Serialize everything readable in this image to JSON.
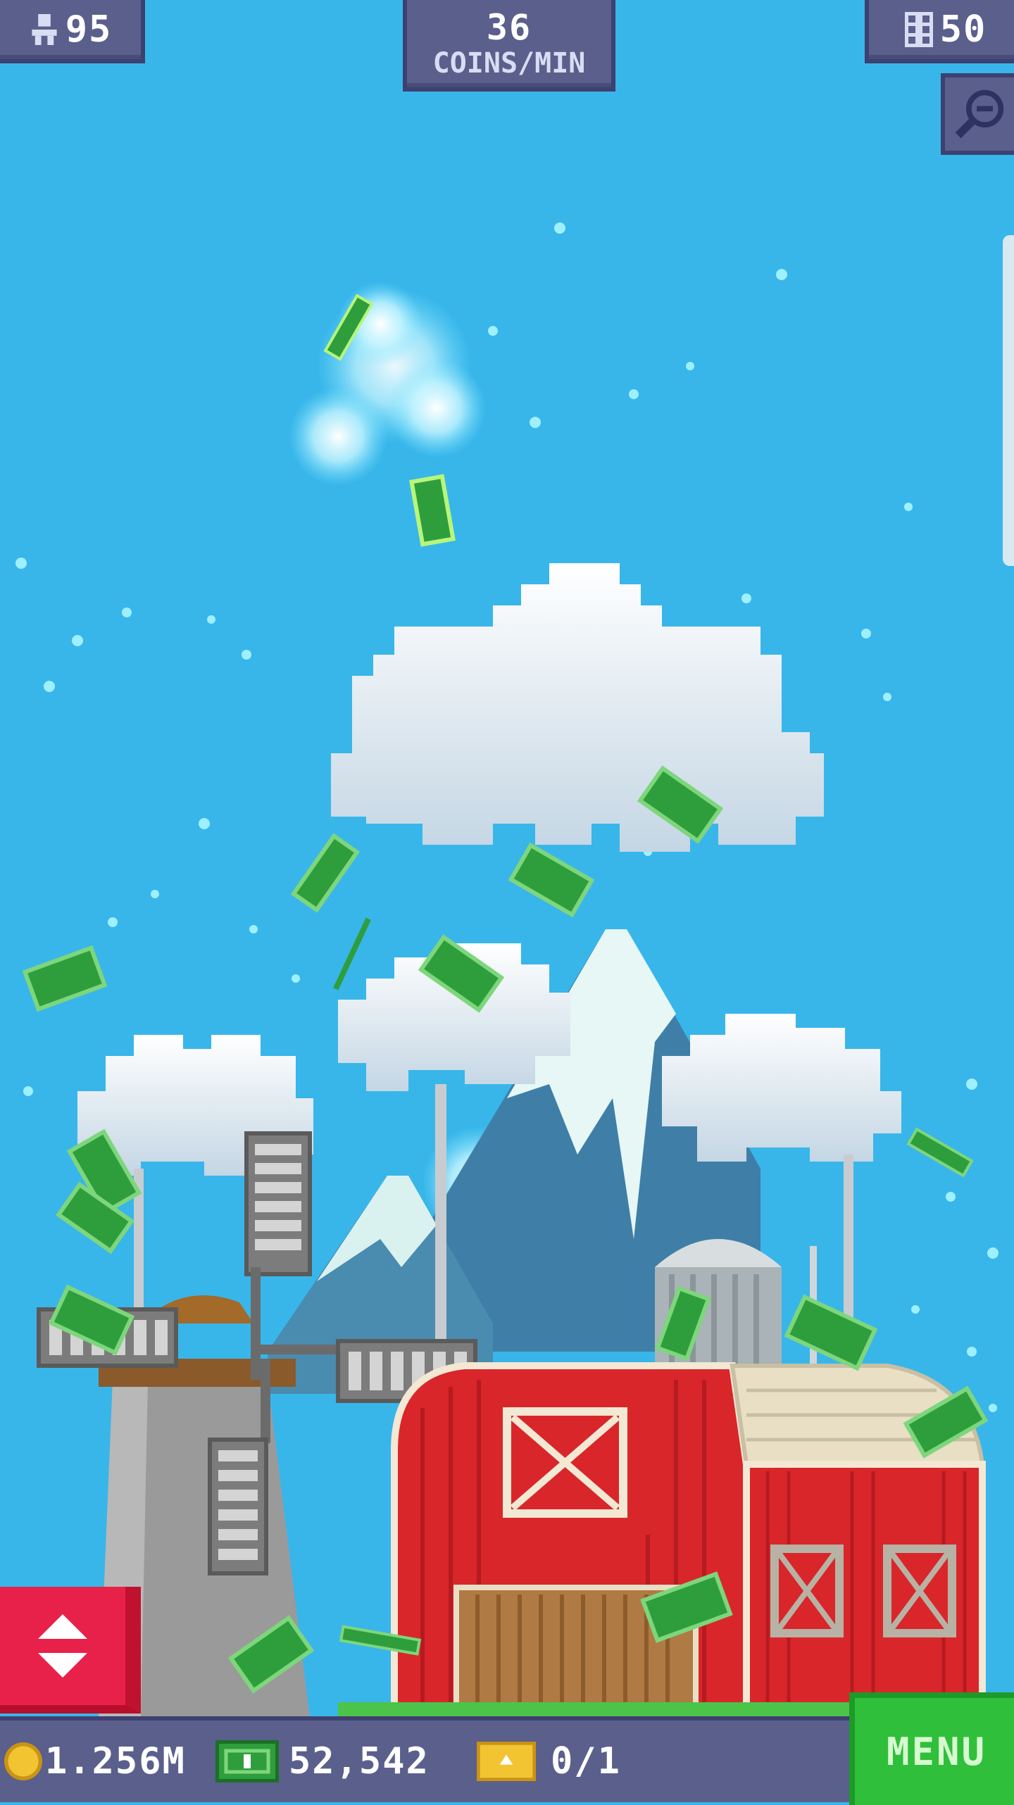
{
  "hud": {
    "population": "95",
    "rate_value": "36",
    "rate_unit": "COINS/MIN",
    "floors": "50"
  },
  "bottom_bar": {
    "coins": "1.256M",
    "bux": "52,542",
    "tickets": "0/1",
    "menu_label": "MENU"
  },
  "icons": {
    "population": "person-icon",
    "floors": "building-icon",
    "zoom": "zoom-out-icon",
    "elevator": "elevator-arrows-icon",
    "coins": "coin-icon",
    "bux": "bux-icon",
    "tickets": "golden-ticket-icon"
  },
  "colors": {
    "sky": "#38b6ea",
    "hud_panel": "#5a5f8c",
    "menu_button": "#2fbf3a",
    "elevator_button": "#e8214a",
    "barn_red": "#d9262b",
    "bux_green": "#2e9e3d"
  }
}
